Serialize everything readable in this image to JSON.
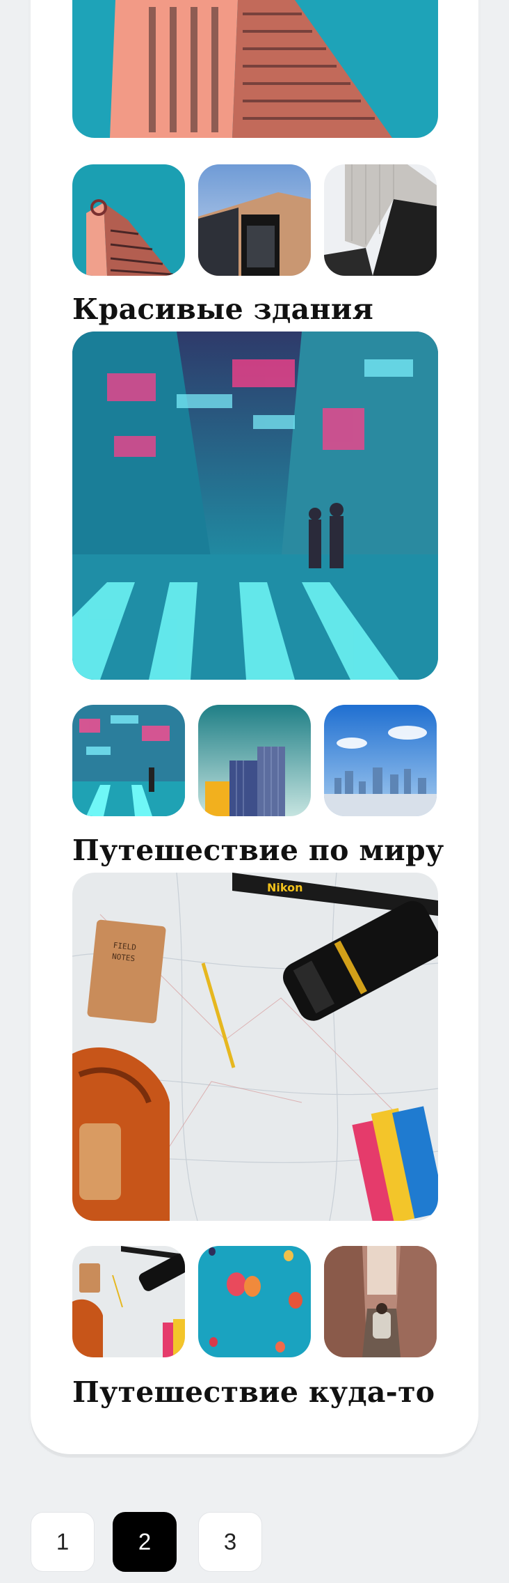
{
  "sections": [
    {
      "title": "Красивые здания",
      "main_image": "nightlife-street-crossing-photo",
      "thumbnails": [
        "nightlife-street-photo",
        "skyscrapers-photo",
        "city-skyline-photo"
      ]
    },
    {
      "title": "Путешествие по миру",
      "main_image": "map-camera-flatlay-photo",
      "thumbnails": [
        "map-camera-flatlay-photo",
        "hot-air-balloons-photo",
        "narrow-alley-traveler-photo"
      ]
    },
    {
      "title": "Путешествие куда-то",
      "main_image": null,
      "thumbnails": []
    }
  ],
  "top_partial": {
    "main_image": "pink-building-photo",
    "thumbnails": [
      "pink-tower-photo",
      "modern-building-photo",
      "white-building-photo"
    ]
  },
  "pagination": {
    "pages": [
      "1",
      "2",
      "3"
    ],
    "active_index": 1
  }
}
